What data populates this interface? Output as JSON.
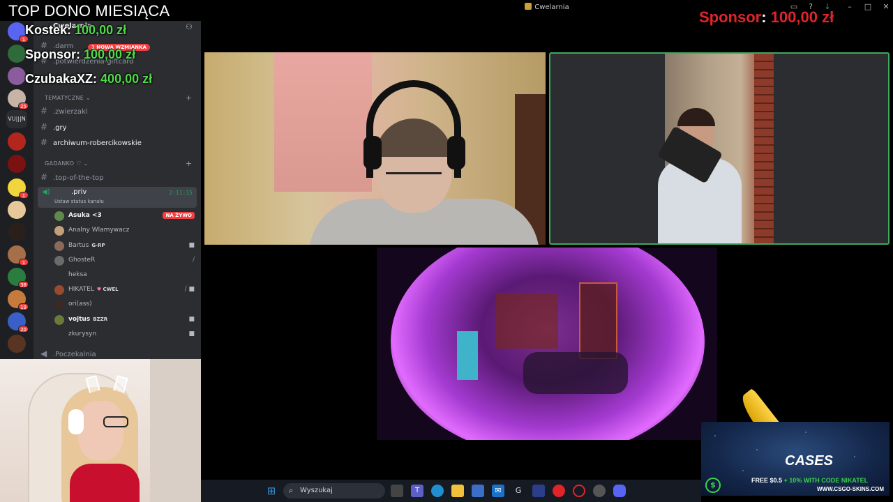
{
  "window": {
    "title": "Cwelarnia"
  },
  "sponsor_banner": {
    "label": "Sponsor",
    "separator": ":",
    "amount": "100,00 zł"
  },
  "donos": {
    "title": "TOP DONO MIESIĄCA",
    "entries": [
      {
        "name": "Kostek:",
        "amount": "100,00 zł"
      },
      {
        "name": "Sponsor:",
        "amount": "100,00 zł"
      },
      {
        "name": "CzubakaXZ:",
        "amount": "400,00 zł"
      }
    ]
  },
  "server_rail": {
    "items": [
      {
        "icon": "server-icon",
        "badge": "1"
      },
      {
        "icon": "server-icon",
        "badge": ""
      },
      {
        "icon": "server-icon",
        "badge": ""
      },
      {
        "icon": "server-icon",
        "badge": "25"
      },
      {
        "icon": "server-icon",
        "label": "VU|||N",
        "badge": ""
      },
      {
        "icon": "server-icon",
        "badge": ""
      },
      {
        "icon": "server-icon",
        "badge": ""
      },
      {
        "icon": "server-icon",
        "badge": "1"
      },
      {
        "icon": "server-icon",
        "badge": ""
      },
      {
        "icon": "server-icon",
        "badge": "1"
      },
      {
        "icon": "server-icon",
        "badge": "38"
      },
      {
        "icon": "server-icon",
        "badge": "19"
      },
      {
        "icon": "server-icon",
        "badge": "20"
      },
      {
        "icon": "server-icon",
        "badge": ""
      }
    ]
  },
  "channels": {
    "server_name": "Cwelarnia",
    "mention_pill": "1 NOWA WZMIANKA",
    "top_items": [
      ".darm",
      ".potwierdzenia-giftcard"
    ],
    "category_tematyczne": "TEMATYCZNE",
    "tematyczne_items": [
      ".zwierzaki",
      ".gry",
      "archiwum-robercikowskie"
    ],
    "category_gadanko": "GADANKO ♡",
    "gadanko_items": [
      ".top-of-the-top"
    ],
    "voice_channel": {
      "name": ".priv",
      "status": "Ustaw status kanału",
      "time": "2:11:15"
    },
    "voice_users": [
      {
        "name": "Asuka <3",
        "bold": true,
        "tag": "",
        "right": "NA ŻYWO"
      },
      {
        "name": "Analny Wlamywacz",
        "bold": false,
        "tag": "",
        "right": ""
      },
      {
        "name": "Bartus",
        "bold": false,
        "tag": "G-RP",
        "right": "video"
      },
      {
        "name": "GhosteR",
        "bold": false,
        "tag": "",
        "right": "muted"
      },
      {
        "name": "heksa",
        "bold": false,
        "tag": "",
        "right": ""
      },
      {
        "name": "HIKATEL",
        "bold": false,
        "tag": "CWEL",
        "right": "muted-video"
      },
      {
        "name": "ori(ass)",
        "bold": false,
        "tag": "",
        "right": ""
      },
      {
        "name": "vojtus",
        "bold": true,
        "tag": "BZZR",
        "right": "video"
      },
      {
        "name": "zkurysyn",
        "bold": false,
        "tag": "",
        "right": "video"
      }
    ],
    "waiting_room": ".Poczekalnia"
  },
  "taskbar": {
    "search_placeholder": "Wyszukaj",
    "apps": [
      "task-view",
      "teams",
      "edge",
      "explorer",
      "store",
      "mail",
      "app-g",
      "app-window",
      "opera-gx",
      "opera",
      "chrome",
      "discord"
    ]
  },
  "promo": {
    "brand": "CASES",
    "offer_prefix": "FREE $0.5",
    "offer_highlight": "+ 10% WITH CODE NIKATEL",
    "url": "WWW.CSGO-SKINS.COM",
    "coin": "$"
  },
  "colors": {
    "accent_green": "#3ea85d",
    "dono_amount": "#51d94a",
    "sponsor_red": "#e0242a",
    "mention_red": "#f23f42"
  }
}
